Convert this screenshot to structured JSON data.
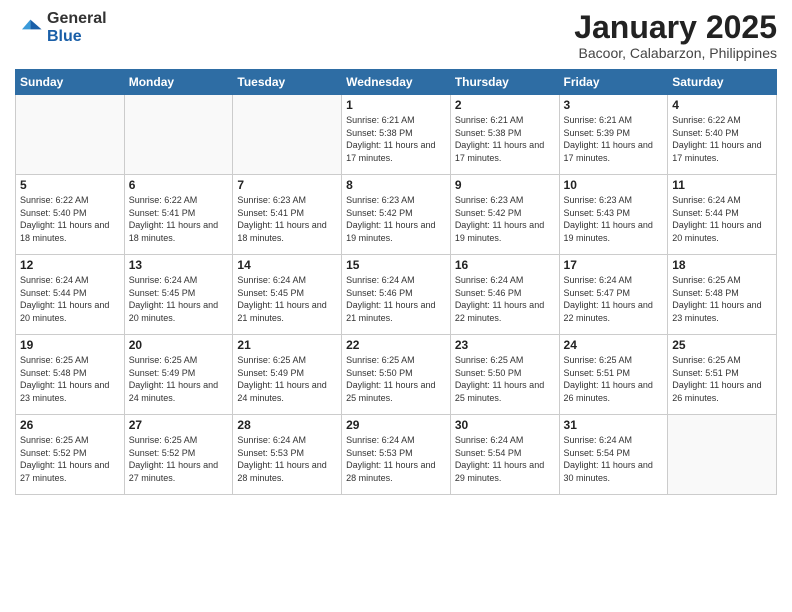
{
  "logo": {
    "general": "General",
    "blue": "Blue"
  },
  "header": {
    "title": "January 2025",
    "subtitle": "Bacoor, Calabarzon, Philippines"
  },
  "weekdays": [
    "Sunday",
    "Monday",
    "Tuesday",
    "Wednesday",
    "Thursday",
    "Friday",
    "Saturday"
  ],
  "weeks": [
    [
      {
        "day": "",
        "info": ""
      },
      {
        "day": "",
        "info": ""
      },
      {
        "day": "",
        "info": ""
      },
      {
        "day": "1",
        "info": "Sunrise: 6:21 AM\nSunset: 5:38 PM\nDaylight: 11 hours and 17 minutes."
      },
      {
        "day": "2",
        "info": "Sunrise: 6:21 AM\nSunset: 5:38 PM\nDaylight: 11 hours and 17 minutes."
      },
      {
        "day": "3",
        "info": "Sunrise: 6:21 AM\nSunset: 5:39 PM\nDaylight: 11 hours and 17 minutes."
      },
      {
        "day": "4",
        "info": "Sunrise: 6:22 AM\nSunset: 5:40 PM\nDaylight: 11 hours and 17 minutes."
      }
    ],
    [
      {
        "day": "5",
        "info": "Sunrise: 6:22 AM\nSunset: 5:40 PM\nDaylight: 11 hours and 18 minutes."
      },
      {
        "day": "6",
        "info": "Sunrise: 6:22 AM\nSunset: 5:41 PM\nDaylight: 11 hours and 18 minutes."
      },
      {
        "day": "7",
        "info": "Sunrise: 6:23 AM\nSunset: 5:41 PM\nDaylight: 11 hours and 18 minutes."
      },
      {
        "day": "8",
        "info": "Sunrise: 6:23 AM\nSunset: 5:42 PM\nDaylight: 11 hours and 19 minutes."
      },
      {
        "day": "9",
        "info": "Sunrise: 6:23 AM\nSunset: 5:42 PM\nDaylight: 11 hours and 19 minutes."
      },
      {
        "day": "10",
        "info": "Sunrise: 6:23 AM\nSunset: 5:43 PM\nDaylight: 11 hours and 19 minutes."
      },
      {
        "day": "11",
        "info": "Sunrise: 6:24 AM\nSunset: 5:44 PM\nDaylight: 11 hours and 20 minutes."
      }
    ],
    [
      {
        "day": "12",
        "info": "Sunrise: 6:24 AM\nSunset: 5:44 PM\nDaylight: 11 hours and 20 minutes."
      },
      {
        "day": "13",
        "info": "Sunrise: 6:24 AM\nSunset: 5:45 PM\nDaylight: 11 hours and 20 minutes."
      },
      {
        "day": "14",
        "info": "Sunrise: 6:24 AM\nSunset: 5:45 PM\nDaylight: 11 hours and 21 minutes."
      },
      {
        "day": "15",
        "info": "Sunrise: 6:24 AM\nSunset: 5:46 PM\nDaylight: 11 hours and 21 minutes."
      },
      {
        "day": "16",
        "info": "Sunrise: 6:24 AM\nSunset: 5:46 PM\nDaylight: 11 hours and 22 minutes."
      },
      {
        "day": "17",
        "info": "Sunrise: 6:24 AM\nSunset: 5:47 PM\nDaylight: 11 hours and 22 minutes."
      },
      {
        "day": "18",
        "info": "Sunrise: 6:25 AM\nSunset: 5:48 PM\nDaylight: 11 hours and 23 minutes."
      }
    ],
    [
      {
        "day": "19",
        "info": "Sunrise: 6:25 AM\nSunset: 5:48 PM\nDaylight: 11 hours and 23 minutes."
      },
      {
        "day": "20",
        "info": "Sunrise: 6:25 AM\nSunset: 5:49 PM\nDaylight: 11 hours and 24 minutes."
      },
      {
        "day": "21",
        "info": "Sunrise: 6:25 AM\nSunset: 5:49 PM\nDaylight: 11 hours and 24 minutes."
      },
      {
        "day": "22",
        "info": "Sunrise: 6:25 AM\nSunset: 5:50 PM\nDaylight: 11 hours and 25 minutes."
      },
      {
        "day": "23",
        "info": "Sunrise: 6:25 AM\nSunset: 5:50 PM\nDaylight: 11 hours and 25 minutes."
      },
      {
        "day": "24",
        "info": "Sunrise: 6:25 AM\nSunset: 5:51 PM\nDaylight: 11 hours and 26 minutes."
      },
      {
        "day": "25",
        "info": "Sunrise: 6:25 AM\nSunset: 5:51 PM\nDaylight: 11 hours and 26 minutes."
      }
    ],
    [
      {
        "day": "26",
        "info": "Sunrise: 6:25 AM\nSunset: 5:52 PM\nDaylight: 11 hours and 27 minutes."
      },
      {
        "day": "27",
        "info": "Sunrise: 6:25 AM\nSunset: 5:52 PM\nDaylight: 11 hours and 27 minutes."
      },
      {
        "day": "28",
        "info": "Sunrise: 6:24 AM\nSunset: 5:53 PM\nDaylight: 11 hours and 28 minutes."
      },
      {
        "day": "29",
        "info": "Sunrise: 6:24 AM\nSunset: 5:53 PM\nDaylight: 11 hours and 28 minutes."
      },
      {
        "day": "30",
        "info": "Sunrise: 6:24 AM\nSunset: 5:54 PM\nDaylight: 11 hours and 29 minutes."
      },
      {
        "day": "31",
        "info": "Sunrise: 6:24 AM\nSunset: 5:54 PM\nDaylight: 11 hours and 30 minutes."
      },
      {
        "day": "",
        "info": ""
      }
    ]
  ]
}
